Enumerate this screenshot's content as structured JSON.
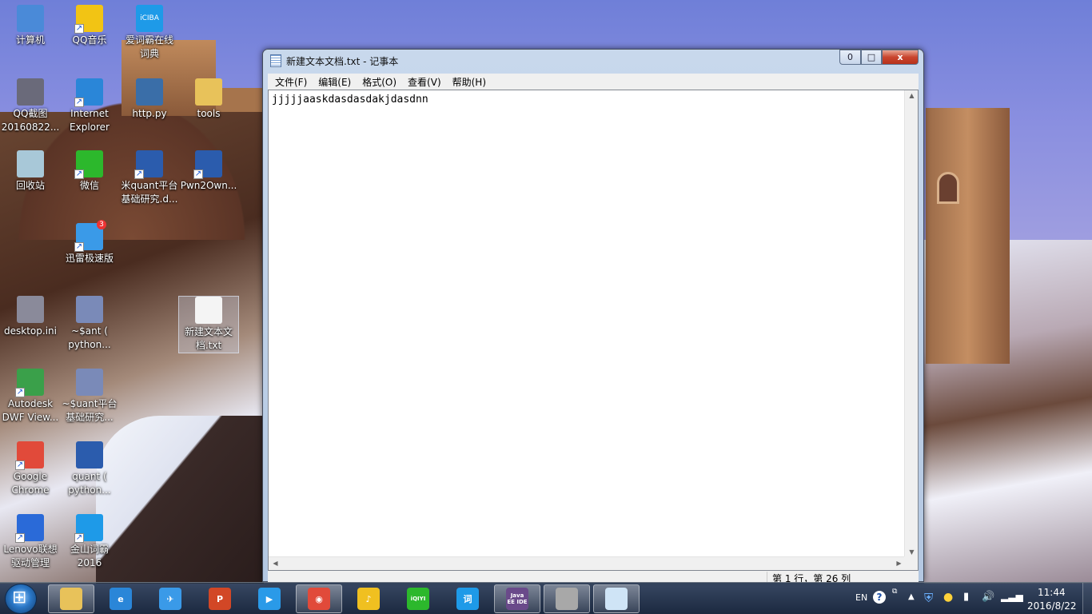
{
  "desktop": {
    "icons": [
      {
        "label": "计算机"
      },
      {
        "label": "QQ音乐"
      },
      {
        "label": "爱词霸在线\n词典",
        "short": "iCIBA"
      },
      {
        "label": "QQ截图\n20160822..."
      },
      {
        "label": "Internet\nExplorer"
      },
      {
        "label": "http.py"
      },
      {
        "label": "tools"
      },
      {
        "label": "回收站"
      },
      {
        "label": "微信"
      },
      {
        "label": "米quant平台\n基础研究.d..."
      },
      {
        "label": "Pwn2Own..."
      },
      {
        "label": "迅雷极速版",
        "badge": "3"
      },
      {
        "label": "desktop.ini"
      },
      {
        "label": "~$ant (\npython..."
      },
      {
        "label": "新建文本文\n档.txt"
      },
      {
        "label": "Autodesk\nDWF View..."
      },
      {
        "label": "~$uant平台\n基础研究..."
      },
      {
        "label": "Google\nChrome"
      },
      {
        "label": "quant (\npython..."
      },
      {
        "label": "Lenovo联想\n驱动管理"
      },
      {
        "label": "金山词霸\n2016"
      }
    ]
  },
  "notepad": {
    "title": "新建文本文档.txt - 记事本",
    "minimize": "0",
    "maximize": "□",
    "close": "x",
    "menu": [
      "文件(F)",
      "编辑(E)",
      "格式(O)",
      "查看(V)",
      "帮助(H)"
    ],
    "content": "jjjjjaaskdasdasdakjdasdnn",
    "status": "第 1 行，第 26 列"
  },
  "taskbar": {
    "apps": [
      {
        "name": "explorer",
        "color": "#e8c25a",
        "glyph": ""
      },
      {
        "name": "internet-explorer",
        "color": "#2a86d8",
        "glyph": "e"
      },
      {
        "name": "xunlei",
        "color": "#3a9ae8",
        "glyph": "✈"
      },
      {
        "name": "powerpoint",
        "color": "#d24726",
        "glyph": "P"
      },
      {
        "name": "video-player",
        "color": "#2a9ae8",
        "glyph": "▶"
      },
      {
        "name": "chrome",
        "color": "#e14a3a",
        "glyph": "◉"
      },
      {
        "name": "qq-music",
        "color": "#f0c020",
        "glyph": "♪"
      },
      {
        "name": "iqiyi",
        "color": "#2cb82c",
        "glyph": "iQIYI"
      },
      {
        "name": "jinshan-ciba",
        "color": "#1e9ae8",
        "glyph": "词"
      },
      {
        "name": "eclipse-javaee",
        "color": "#6a4a8a",
        "glyph": "Java EE IDE"
      },
      {
        "name": "image-viewer",
        "color": "#a8a8a8",
        "glyph": ""
      },
      {
        "name": "notepad",
        "color": "#cfe4f6",
        "glyph": ""
      }
    ],
    "tray": {
      "lang": "EN",
      "time": "11:44",
      "date": "2016/8/22"
    }
  }
}
